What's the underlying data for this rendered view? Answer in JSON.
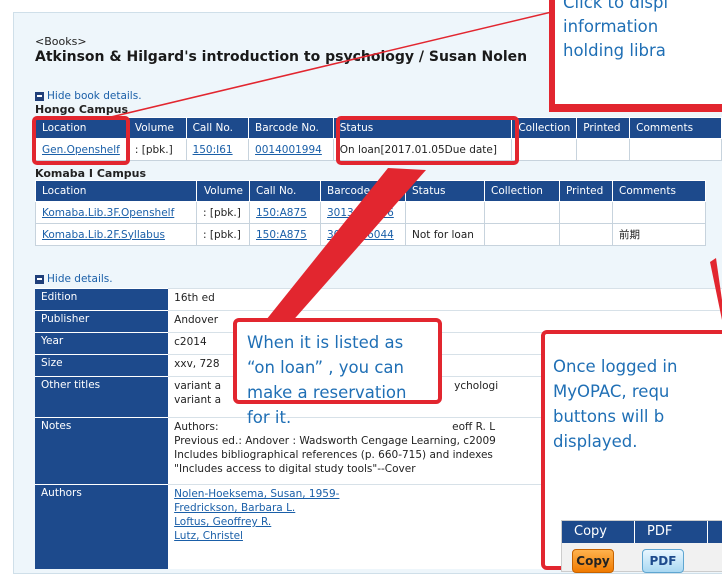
{
  "book": {
    "category": "<Books>",
    "title": "Atkinson & Hilgard's introduction to psychology / Susan Nolen"
  },
  "toggles": {
    "hide_book_details": "Hide book details.",
    "hide_details": "Hide details."
  },
  "hongo": {
    "campus": "Hongo Campus",
    "headers": [
      "Location",
      "Volume",
      "Call No.",
      "Barcode No.",
      "Status",
      "Collection",
      "Printed",
      "Comments"
    ],
    "rows": [
      {
        "location": "Gen.Openshelf",
        "volume": ": [pbk.]",
        "call": "150:I61",
        "barcode": "0014001994",
        "status": "On loan[2017.01.05Due date]",
        "collection": "",
        "printed": "",
        "comments": ""
      }
    ]
  },
  "komaba": {
    "campus": "Komaba I Campus",
    "headers": [
      "Location",
      "Volume",
      "Call No.",
      "Barcode No.",
      "Status",
      "Collection",
      "Printed",
      "Comments"
    ],
    "rows": [
      {
        "location": "Komaba.Lib.3F.Openshelf",
        "volume": ": [pbk.]",
        "call": "150:A875",
        "barcode": "3013466036",
        "status": "",
        "collection": "",
        "printed": "",
        "comments": ""
      },
      {
        "location": "Komaba.Lib.2F.Syllabus",
        "volume": ": [pbk.]",
        "call": "150:A875",
        "barcode": "3013466044",
        "status": "Not for loan",
        "collection": "",
        "printed": "",
        "comments": "前期"
      }
    ]
  },
  "details": {
    "edition": {
      "label": "Edition",
      "value": "16th ed"
    },
    "publisher": {
      "label": "Publisher",
      "value": "Andover"
    },
    "year": {
      "label": "Year",
      "value": "c2014"
    },
    "size": {
      "label": "Size",
      "value": "xxv, 728"
    },
    "other_titles": {
      "label": "Other titles",
      "line1": "variant a",
      "line2": "variant a",
      "tail": "ychologi"
    },
    "notes": {
      "label": "Notes",
      "line1": "Authors:",
      "line1_tail": "eoff R. L",
      "line2": "Previous ed.: Andover : Wadsworth Cengage Learning, c2009",
      "line3": "Includes bibliographical references (p. 660-715) and indexes",
      "line4": "\"Includes access to digital study tools\"--Cover"
    },
    "authors": {
      "label": "Authors",
      "names": [
        "Nolen-Hoeksema, Susan, 1959-",
        "Fredrickson, Barbara L.",
        "Loftus, Geoffrey R.",
        "Lutz, Christel"
      ]
    }
  },
  "callouts": {
    "top_right": [
      "Click to displ",
      "information",
      "holding libra"
    ],
    "loan": "When it is listed as “on loan” , you can make a reservation for it.",
    "myopac": "Once logged in MyOPAC, requ buttons will b displayed."
  },
  "request_buttons": {
    "headers": [
      "Copy",
      "PDF"
    ],
    "copy_label": "Copy",
    "pdf_label": "PDF"
  },
  "colors": {
    "header_blue": "#1d4a8c",
    "link": "#1a5fa8",
    "highlight_red": "#e2262f",
    "callout_text": "#1f6fb5"
  }
}
